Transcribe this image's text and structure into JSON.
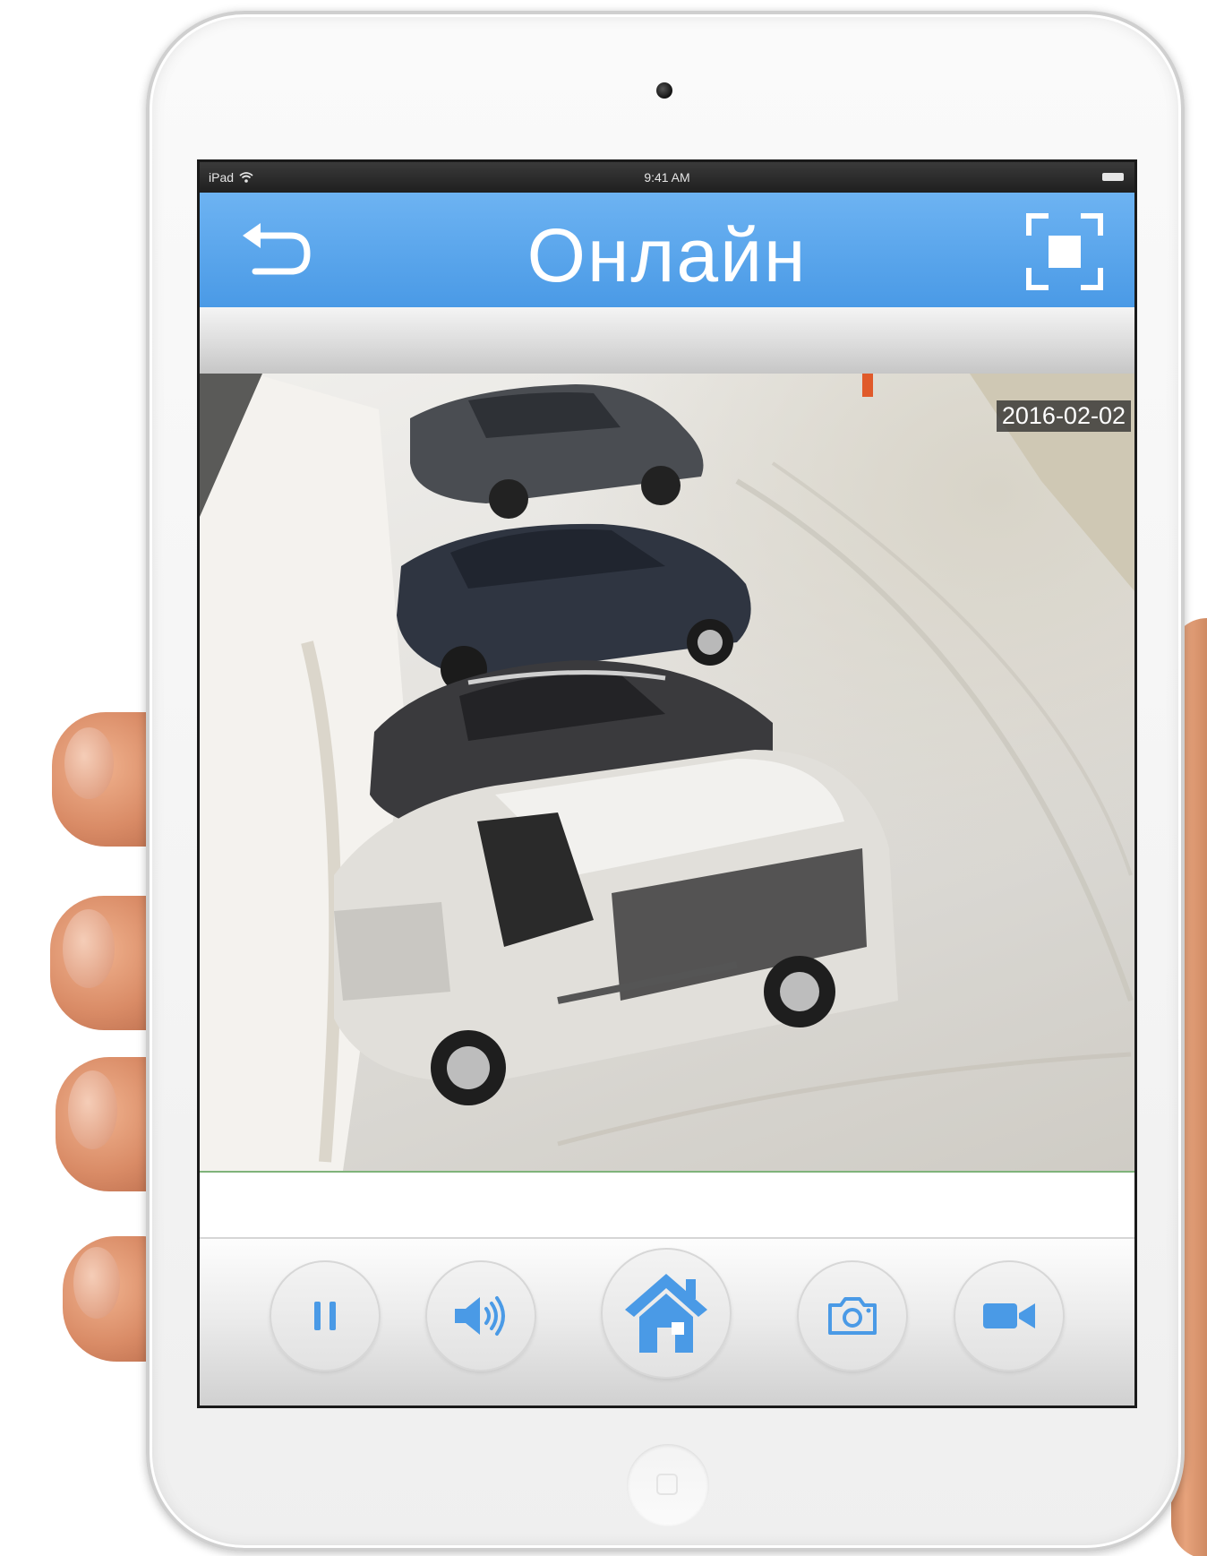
{
  "status_bar": {
    "device": "iPad",
    "time": "9:41 AM"
  },
  "nav": {
    "title": "Онлайн",
    "back_icon": "back-arrow-icon",
    "fullscreen_icon": "fullscreen-icon",
    "accent_color": "#4a9ae6"
  },
  "video": {
    "timestamp": "2016-02-02"
  },
  "toolbar": {
    "buttons": [
      {
        "name": "pause",
        "icon": "pause-icon"
      },
      {
        "name": "sound",
        "icon": "speaker-icon"
      },
      {
        "name": "home",
        "icon": "home-icon"
      },
      {
        "name": "snapshot",
        "icon": "camera-icon"
      },
      {
        "name": "record",
        "icon": "video-camera-icon"
      }
    ],
    "icon_color": "#4a9ae6"
  }
}
